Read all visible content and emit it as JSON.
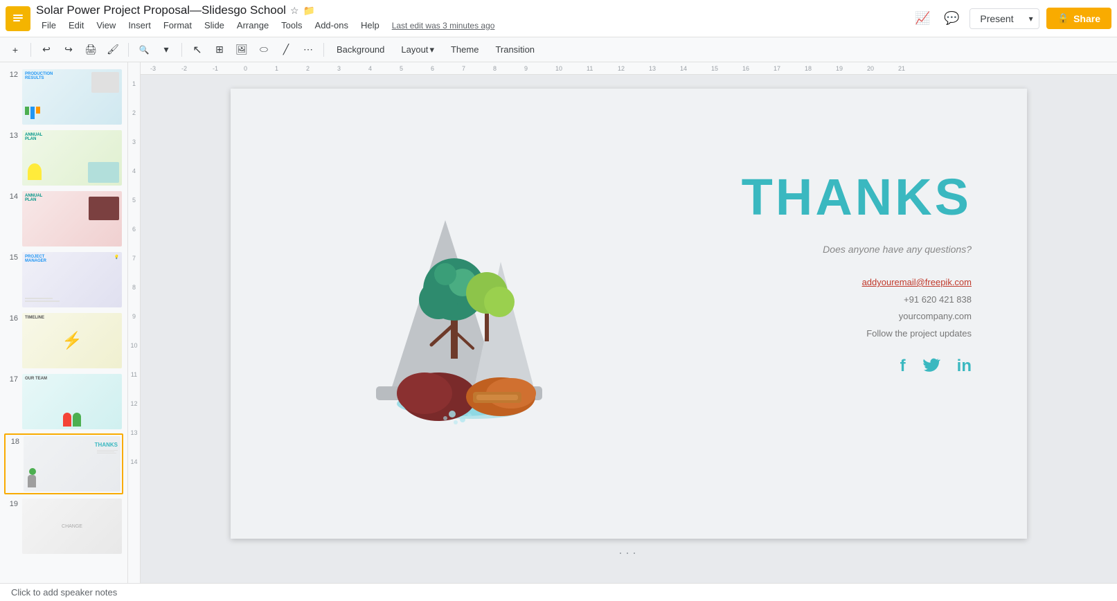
{
  "app": {
    "logo": "S",
    "title": "Solar Power Project Proposal—Slidesgo School",
    "last_edit": "Last edit was 3 minutes ago"
  },
  "menu": {
    "file": "File",
    "edit": "Edit",
    "view": "View",
    "insert": "Insert",
    "format": "Format",
    "slide": "Slide",
    "arrange": "Arrange",
    "tools": "Tools",
    "addons": "Add-ons",
    "help": "Help"
  },
  "toolbar": {
    "background": "Background",
    "layout": "Layout",
    "layout_arrow": "▾",
    "theme": "Theme",
    "transition": "Transition"
  },
  "header_right": {
    "present": "Present",
    "present_arrow": "▾",
    "share_icon": "🔒",
    "share": "Share"
  },
  "slide_panel": {
    "slides": [
      {
        "num": "12",
        "class": "thumb-12"
      },
      {
        "num": "13",
        "class": "thumb-13"
      },
      {
        "num": "14",
        "class": "thumb-14"
      },
      {
        "num": "15",
        "class": "thumb-15"
      },
      {
        "num": "16",
        "class": "thumb-16"
      },
      {
        "num": "17",
        "class": "thumb-17"
      },
      {
        "num": "18",
        "class": "thumb-18",
        "active": true
      },
      {
        "num": "19",
        "class": "thumb-19"
      }
    ]
  },
  "slide_content": {
    "thanks": "THANKS",
    "question": "Does anyone have any questions?",
    "email": "addyouremail@freepik.com",
    "phone": "+91 620 421 838",
    "website": "yourcompany.com",
    "follow": "Follow the project updates",
    "social_facebook": "f",
    "social_twitter": "t",
    "social_linkedin": "in"
  },
  "ruler": {
    "marks": [
      "-3",
      "-2",
      "-1",
      "0",
      "1",
      "2",
      "3",
      "4",
      "5",
      "6",
      "7",
      "8",
      "9",
      "10",
      "11",
      "12",
      "13",
      "14",
      "15",
      "16",
      "17",
      "18",
      "19",
      "20",
      "21"
    ],
    "v_marks": [
      "1",
      "2",
      "3",
      "4",
      "5",
      "6",
      "7",
      "8",
      "9",
      "10",
      "11",
      "12",
      "13",
      "14"
    ]
  },
  "notes": {
    "placeholder": "Click to add speaker notes"
  }
}
